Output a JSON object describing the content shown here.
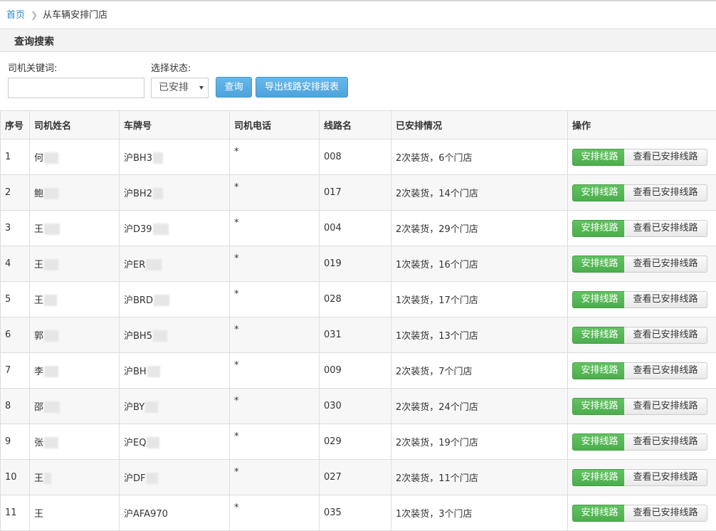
{
  "breadcrumb": {
    "home": "首页",
    "current": "从车辆安排门店"
  },
  "search": {
    "title": "查询搜索",
    "keyword_label": "司机关键词:",
    "keyword_value": "",
    "status_label": "选择状态:",
    "status_value": "已安排",
    "query_button": "查询",
    "export_button": "导出线路安排报表"
  },
  "table": {
    "headers": [
      "序号",
      "司机姓名",
      "车牌号",
      "司机电话",
      "线路名",
      "已安排情况",
      "操作"
    ],
    "assign_label": "安排线路",
    "view_label": "查看已安排线路",
    "rows": [
      {
        "no": "1",
        "name": "何",
        "plate": "沪BH3",
        "phone": "*",
        "route": "008",
        "status": "2次装货，6个门店"
      },
      {
        "no": "2",
        "name": "鲍",
        "plate": "沪BH2",
        "phone": "*",
        "route": "017",
        "status": "2次装货，14个门店"
      },
      {
        "no": "3",
        "name": "王",
        "plate": "沪D39",
        "phone": "*",
        "route": "004",
        "status": "2次装货，29个门店"
      },
      {
        "no": "4",
        "name": "王",
        "plate": "沪ER",
        "phone": "*",
        "route": "019",
        "status": "1次装货，16个门店"
      },
      {
        "no": "5",
        "name": "王",
        "plate": "沪BRD",
        "phone": "*",
        "route": "028",
        "status": "1次装货，17个门店"
      },
      {
        "no": "6",
        "name": "郭",
        "plate": "沪BH5",
        "phone": "*",
        "route": "031",
        "status": "1次装货，13个门店"
      },
      {
        "no": "7",
        "name": "李",
        "plate": "沪BH",
        "phone": "*",
        "route": "009",
        "status": "2次装货，7个门店"
      },
      {
        "no": "8",
        "name": "邵",
        "plate": "沪BY",
        "phone": "*",
        "route": "030",
        "status": "2次装货，24个门店"
      },
      {
        "no": "9",
        "name": "张",
        "plate": "沪EQ",
        "phone": "*",
        "route": "029",
        "status": "2次装货，19个门店"
      },
      {
        "no": "10",
        "name": "王",
        "plate": "沪DF",
        "phone": "*",
        "route": "027",
        "status": "2次装货，11个门店"
      },
      {
        "no": "11",
        "name": "王",
        "plate": "沪AFA970",
        "phone": "*",
        "route": "035",
        "status": "1次装货，3个门店"
      }
    ]
  }
}
